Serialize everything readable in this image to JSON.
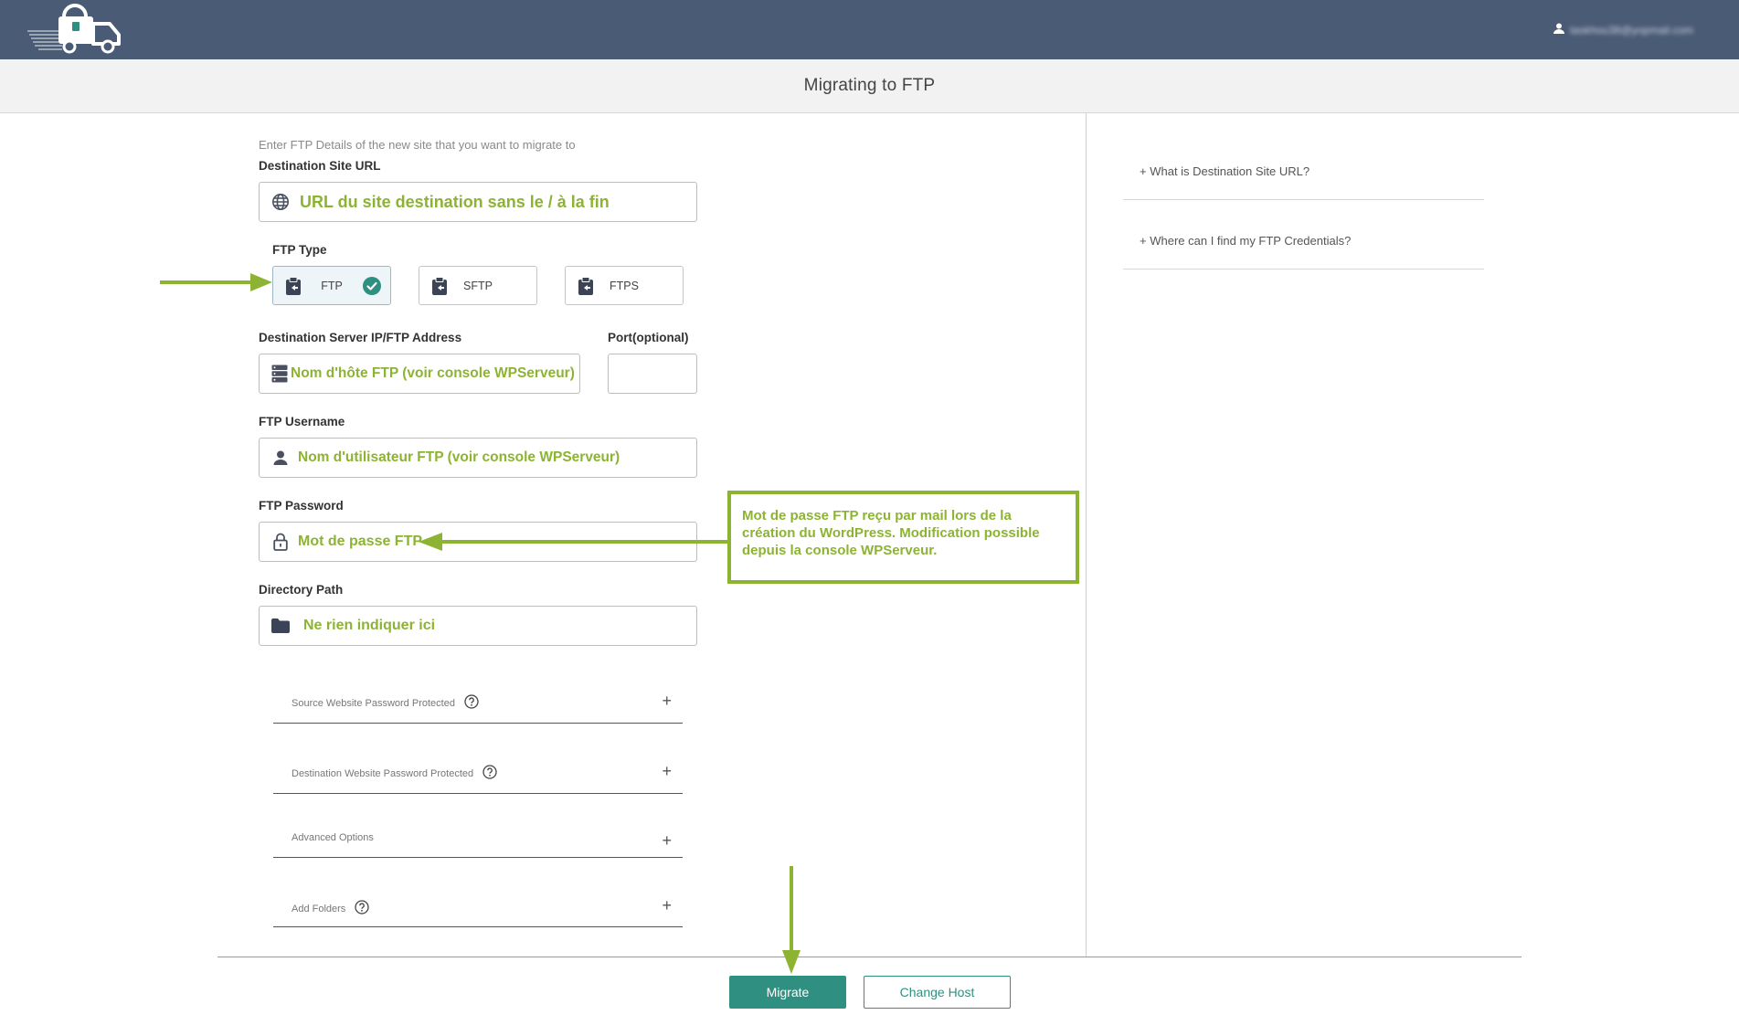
{
  "header": {
    "user_email": "taskhou38@yopmail.com"
  },
  "title": "Migrating to FTP",
  "form": {
    "intro": "Enter FTP Details of the new site that you want to migrate to",
    "destination_url": {
      "label": "Destination Site URL",
      "value": "URL du site destination sans le / à la fin"
    },
    "ftp_type": {
      "label": "FTP Type",
      "options": [
        "FTP",
        "SFTP",
        "FTPS"
      ],
      "selected": "FTP"
    },
    "server": {
      "label": "Destination Server IP/FTP Address",
      "value": "Nom d'hôte FTP (voir console WPServeur)"
    },
    "port": {
      "label": "Port(optional)",
      "value": ""
    },
    "username": {
      "label": "FTP Username",
      "value": "Nom d'utilisateur FTP (voir console WPServeur)"
    },
    "password": {
      "label": "FTP Password",
      "value": "Mot de passe FTP"
    },
    "directory": {
      "label": "Directory Path",
      "value": "Ne rien indiquer ici"
    },
    "accordions": [
      "Source Website Password Protected",
      "Destination Website Password Protected",
      "Advanced Options",
      "Add Folders"
    ]
  },
  "help": [
    "What is Destination Site URL?",
    "Where can I find my FTP Credentials?"
  ],
  "buttons": {
    "migrate": "Migrate",
    "change_host": "Change Host"
  },
  "annotation": {
    "text": "Mot de passe FTP reçu par mail lors de la création du WordPress. Modification possible depuis la console WPServeur."
  },
  "colors": {
    "header": "#4a5b75",
    "accent": "#2f8f80",
    "annotation": "#8db333"
  }
}
